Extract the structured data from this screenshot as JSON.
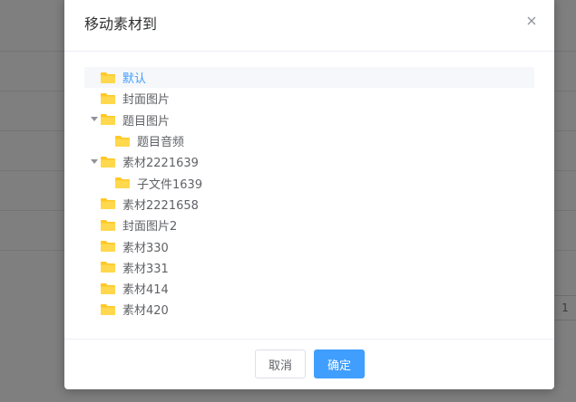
{
  "dialog": {
    "title": "移动素材到",
    "close_icon": "close-icon"
  },
  "tree": {
    "folder_color": "#ffc825",
    "selected_color": "#409eff",
    "nodes": [
      {
        "label": "默认",
        "level": 0,
        "expandable": false,
        "selected": true
      },
      {
        "label": "封面图片",
        "level": 0,
        "expandable": false,
        "selected": false
      },
      {
        "label": "题目图片",
        "level": 0,
        "expandable": true,
        "expanded": true,
        "selected": false
      },
      {
        "label": "题目音频",
        "level": 1,
        "expandable": false,
        "selected": false
      },
      {
        "label": "素材2221639",
        "level": 0,
        "expandable": true,
        "expanded": true,
        "selected": false
      },
      {
        "label": "子文件1639",
        "level": 1,
        "expandable": false,
        "selected": false
      },
      {
        "label": "素材2221658",
        "level": 0,
        "expandable": false,
        "selected": false
      },
      {
        "label": "封面图片2",
        "level": 0,
        "expandable": false,
        "selected": false
      },
      {
        "label": "素材330",
        "level": 0,
        "expandable": false,
        "selected": false
      },
      {
        "label": "素材331",
        "level": 0,
        "expandable": false,
        "selected": false
      },
      {
        "label": "素材414",
        "level": 0,
        "expandable": false,
        "selected": false
      },
      {
        "label": "素材420",
        "level": 0,
        "expandable": false,
        "selected": false
      }
    ]
  },
  "footer": {
    "cancel_label": "取消",
    "confirm_label": "确定"
  },
  "background": {
    "cell_text": "1"
  }
}
